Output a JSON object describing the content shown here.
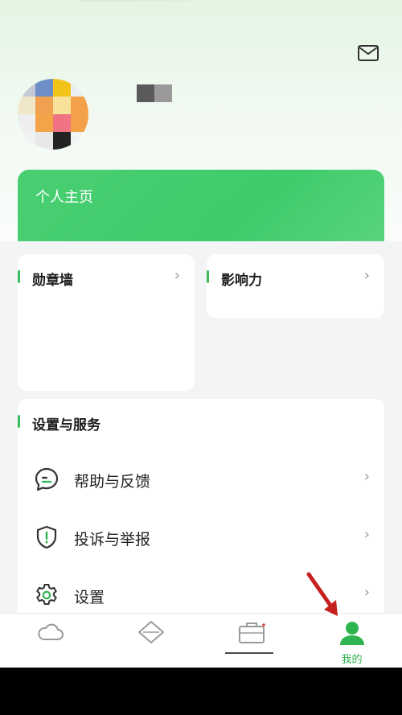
{
  "header": {
    "mail_icon": "mail-icon"
  },
  "profile": {
    "avatar_colors": [
      "#c5c9d6",
      "#6d8ec6",
      "#f2c41a",
      "#e9eef3",
      "#f0e6c8",
      "#f0a14f",
      "#f8e29a",
      "#f3a24a",
      "#eeeeee",
      "#f4a448",
      "#f07383",
      "#f3a148",
      "#eef0f1",
      "#e8e8e8",
      "#232323",
      "#f3f3f3"
    ],
    "username_colors": [
      "#5a5a5a",
      "#9a9a9a"
    ]
  },
  "home_card": {
    "label": "个人主页"
  },
  "cards": {
    "badges_title": "勋章墙",
    "influence_title": "影响力",
    "services_title": "设置与服务"
  },
  "services": [
    {
      "label": "帮助与反馈",
      "icon": "chat-help-icon"
    },
    {
      "label": "投诉与举报",
      "icon": "shield-alert-icon"
    },
    {
      "label": "设置",
      "icon": "gear-icon"
    }
  ],
  "tabbar": {
    "tabs": [
      {
        "icon": "cloud-icon",
        "label": "",
        "active": false
      },
      {
        "icon": "diamond-icon",
        "label": "",
        "active": false
      },
      {
        "icon": "briefcase-icon",
        "label": "",
        "active": false
      },
      {
        "icon": "user-icon",
        "label": "我的",
        "active": true
      }
    ],
    "active_color": "#2fb550",
    "inactive_color": "#9a9a9a"
  },
  "annotation": {
    "arrow_color": "#c62020"
  }
}
